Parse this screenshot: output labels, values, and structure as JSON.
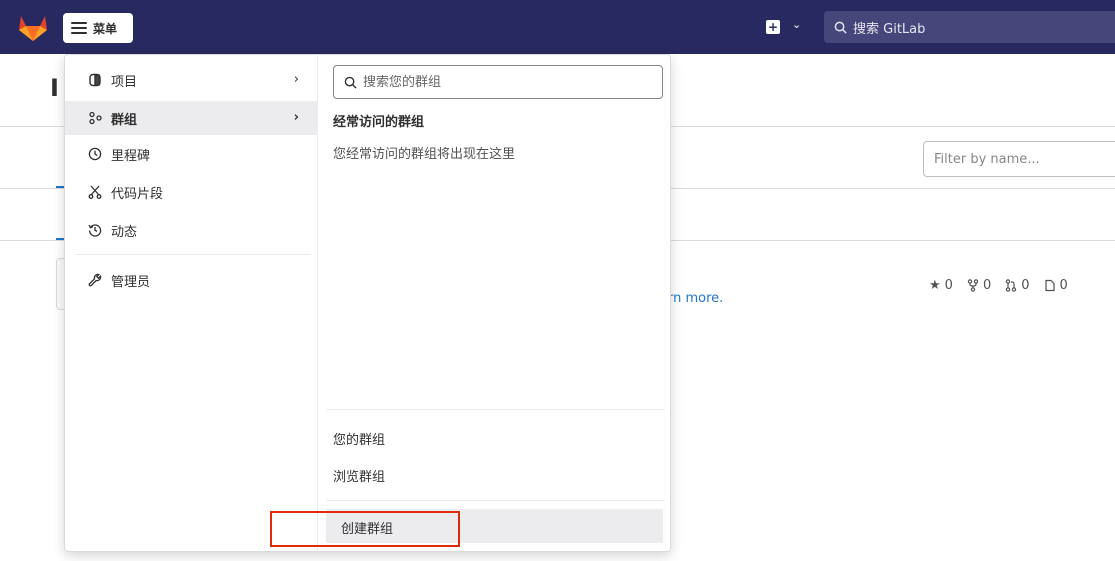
{
  "topbar": {
    "menu_label": "菜单",
    "new_icon": "plus-square-icon",
    "search_placeholder": "搜索 GitLab",
    "brand_color": "#292961"
  },
  "background": {
    "title_fragment": "I",
    "filter_placeholder": "Filter by name...",
    "learn_more_fragment": "rn more.",
    "stats": {
      "stars": "0",
      "forks": "0",
      "merge_requests": "0",
      "issues": "0"
    }
  },
  "dropdown": {
    "left_items": [
      {
        "label": "项目",
        "icon": "project-icon",
        "has_chevron": true
      },
      {
        "label": "群组",
        "icon": "group-icon",
        "has_chevron": true,
        "active": true
      },
      {
        "label": "里程碑",
        "icon": "clock-icon"
      },
      {
        "label": "代码片段",
        "icon": "snippet-icon"
      },
      {
        "label": "动态",
        "icon": "history-icon"
      },
      {
        "label": "管理员",
        "icon": "admin-wrench-icon"
      }
    ],
    "chevron": "›",
    "right": {
      "search_placeholder": "搜索您的群组",
      "frequent_title": "经常访问的群组",
      "frequent_empty": "您经常访问的群组将出现在这里",
      "your_groups": "您的群组",
      "explore_groups": "浏览群组",
      "create_group": "创建群组"
    },
    "highlight_color": "#dd2b0e"
  }
}
